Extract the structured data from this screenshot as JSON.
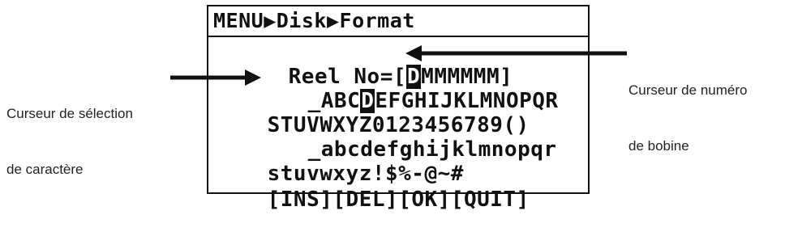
{
  "screen": {
    "title": "MENU▶Disk▶Format",
    "reel_label": "Reel No=[",
    "reel_cursor_char": "D",
    "reel_rest": "MMMMMM]",
    "char_row1_pre": "_ABC",
    "char_row1_cursor": "D",
    "char_row1_post": "EFGHIJKLMNOPQR",
    "char_row2": "STUVWXYZ0123456789()",
    "char_row3": "_abcdefghijklmnopqr",
    "char_row4": "stuvwxyz!$%-@~#",
    "buttons": {
      "ins": "[INS]",
      "del": "[DEL]",
      "ok": "[OK]",
      "quit": "[QUIT]"
    }
  },
  "callouts": {
    "char_cursor_line1": "Curseur de sélection",
    "char_cursor_line2": "de caractère",
    "reel_cursor_line1": "Curseur de numéro",
    "reel_cursor_line2": "de bobine"
  }
}
